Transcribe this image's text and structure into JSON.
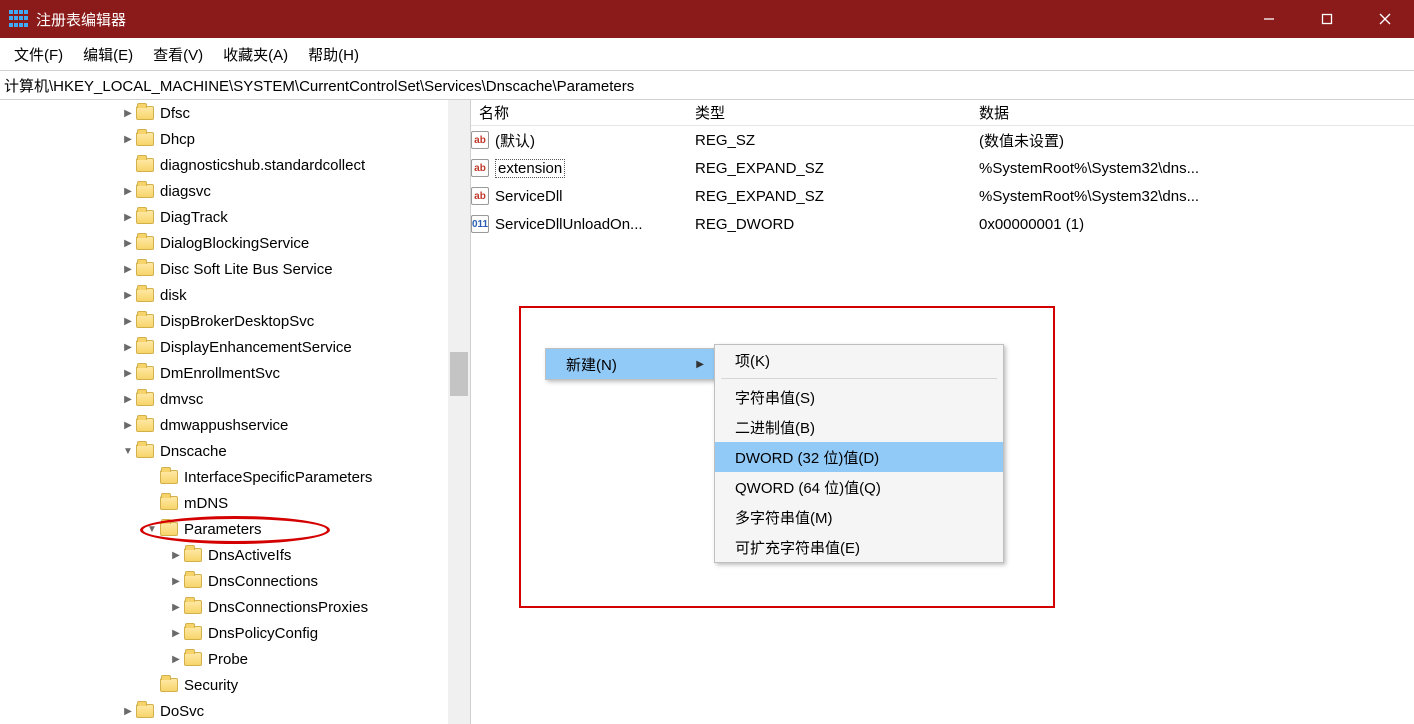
{
  "window": {
    "title": "注册表编辑器"
  },
  "menu": {
    "file": "文件(F)",
    "edit": "编辑(E)",
    "view": "查看(V)",
    "favorites": "收藏夹(A)",
    "help": "帮助(H)"
  },
  "address": {
    "path": "计算机\\HKEY_LOCAL_MACHINE\\SYSTEM\\CurrentControlSet\\Services\\Dnscache\\Parameters"
  },
  "tree": {
    "items": [
      {
        "indent": 5,
        "expander": ">",
        "label": "Dfsc"
      },
      {
        "indent": 5,
        "expander": ">",
        "label": "Dhcp"
      },
      {
        "indent": 5,
        "expander": "",
        "label": "diagnosticshub.standardcollect"
      },
      {
        "indent": 5,
        "expander": ">",
        "label": "diagsvc"
      },
      {
        "indent": 5,
        "expander": ">",
        "label": "DiagTrack"
      },
      {
        "indent": 5,
        "expander": ">",
        "label": "DialogBlockingService"
      },
      {
        "indent": 5,
        "expander": ">",
        "label": "Disc Soft Lite Bus Service"
      },
      {
        "indent": 5,
        "expander": ">",
        "label": "disk"
      },
      {
        "indent": 5,
        "expander": ">",
        "label": "DispBrokerDesktopSvc"
      },
      {
        "indent": 5,
        "expander": ">",
        "label": "DisplayEnhancementService"
      },
      {
        "indent": 5,
        "expander": ">",
        "label": "DmEnrollmentSvc"
      },
      {
        "indent": 5,
        "expander": ">",
        "label": "dmvsc"
      },
      {
        "indent": 5,
        "expander": ">",
        "label": "dmwappushservice"
      },
      {
        "indent": 5,
        "expander": "v",
        "label": "Dnscache"
      },
      {
        "indent": 6,
        "expander": "",
        "label": "InterfaceSpecificParameters"
      },
      {
        "indent": 6,
        "expander": "",
        "label": "mDNS"
      },
      {
        "indent": 6,
        "expander": "v",
        "label": "Parameters",
        "selected": true
      },
      {
        "indent": 7,
        "expander": ">",
        "label": "DnsActiveIfs"
      },
      {
        "indent": 7,
        "expander": ">",
        "label": "DnsConnections"
      },
      {
        "indent": 7,
        "expander": ">",
        "label": "DnsConnectionsProxies"
      },
      {
        "indent": 7,
        "expander": ">",
        "label": "DnsPolicyConfig"
      },
      {
        "indent": 7,
        "expander": ">",
        "label": "Probe"
      },
      {
        "indent": 6,
        "expander": "",
        "label": "Security"
      },
      {
        "indent": 5,
        "expander": ">",
        "label": "DoSvc"
      }
    ]
  },
  "list": {
    "headers": {
      "name": "名称",
      "type": "类型",
      "data": "数据"
    },
    "rows": [
      {
        "icon": "ab",
        "name": "(默认)",
        "type": "REG_SZ",
        "data": "(数值未设置)",
        "editing": false
      },
      {
        "icon": "ab",
        "name": "extension",
        "type": "REG_EXPAND_SZ",
        "data": "%SystemRoot%\\System32\\dns...",
        "editing": true
      },
      {
        "icon": "ab",
        "name": "ServiceDll",
        "type": "REG_EXPAND_SZ",
        "data": "%SystemRoot%\\System32\\dns...",
        "editing": false
      },
      {
        "icon": "dw",
        "name": "ServiceDllUnloadOn...",
        "type": "REG_DWORD",
        "data": "0x00000001 (1)",
        "editing": false
      }
    ]
  },
  "context": {
    "parent": {
      "label": "新建(N)"
    },
    "submenu": {
      "key": "项(K)",
      "string": "字符串值(S)",
      "binary": "二进制值(B)",
      "dword": "DWORD (32 位)值(D)",
      "qword": "QWORD (64 位)值(Q)",
      "multi": "多字符串值(M)",
      "expand": "可扩充字符串值(E)"
    }
  }
}
